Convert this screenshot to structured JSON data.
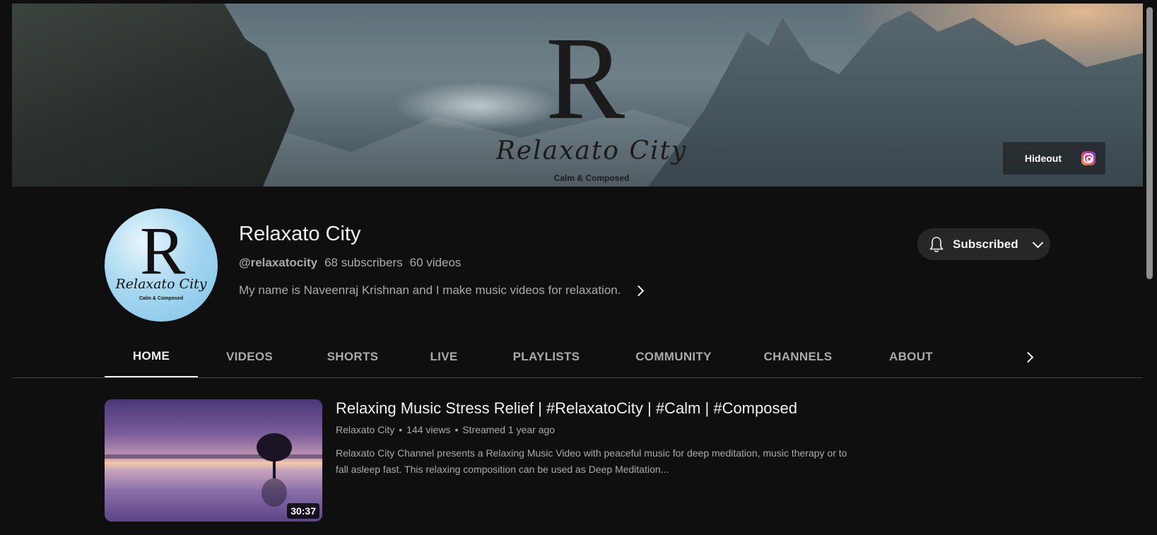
{
  "banner": {
    "logo_letter": "R",
    "logo_wordmark": "Relaxato City",
    "logo_tagline": "Calm & Composed",
    "link_label": "Hideout",
    "link_icon": "instagram-icon"
  },
  "channel": {
    "avatar_letter": "R",
    "avatar_wordmark": "Relaxato City",
    "avatar_tagline": "Calm & Composed",
    "name": "Relaxato City",
    "handle": "@relaxatocity",
    "subscribers": "68 subscribers",
    "videos": "60 videos",
    "description": "My name is Naveenraj Krishnan and I make music videos for relaxation."
  },
  "subscribe": {
    "label": "Subscribed",
    "icon": "bell-icon"
  },
  "tabs": [
    {
      "label": "HOME",
      "active": true
    },
    {
      "label": "VIDEOS"
    },
    {
      "label": "SHORTS"
    },
    {
      "label": "LIVE"
    },
    {
      "label": "PLAYLISTS"
    },
    {
      "label": "COMMUNITY"
    },
    {
      "label": "CHANNELS"
    },
    {
      "label": "ABOUT"
    }
  ],
  "featured": {
    "title": "Relaxing Music Stress Relief | #RelaxatoCity | #Calm | #Composed",
    "channel": "Relaxato City",
    "separator": "•",
    "views": "144 views",
    "streamed": "Streamed 1 year ago",
    "description": "Relaxato City Channel presents a Relaxing Music Video with peaceful music for deep meditation, music therapy or to fall asleep fast. This relaxing composition can be used as Deep Meditation...",
    "duration": "30:37"
  },
  "colors": {
    "background": "#0f0f0f",
    "text_primary": "#f1f1f1",
    "text_secondary": "#aaaaaa",
    "button_bg": "#272727"
  }
}
